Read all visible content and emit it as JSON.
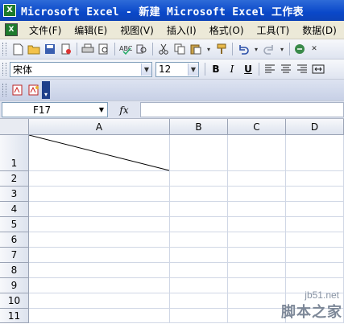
{
  "window": {
    "title": "Microsoft Excel - 新建 Microsoft Excel 工作表"
  },
  "menu": {
    "items": [
      {
        "label": "文件(F)"
      },
      {
        "label": "编辑(E)"
      },
      {
        "label": "视图(V)"
      },
      {
        "label": "插入(I)"
      },
      {
        "label": "格式(O)"
      },
      {
        "label": "工具(T)"
      },
      {
        "label": "数据(D)"
      }
    ]
  },
  "formatting": {
    "font_name": "宋体",
    "font_size": "12",
    "bold_label": "B",
    "italic_label": "I",
    "underline_label": "U"
  },
  "formula_bar": {
    "name_box": "F17",
    "fx_label": "fx",
    "formula": ""
  },
  "sheet": {
    "columns": [
      "A",
      "B",
      "C",
      "D"
    ],
    "rows": [
      "1",
      "2",
      "3",
      "4",
      "5",
      "6",
      "7",
      "8",
      "9",
      "10",
      "11"
    ]
  },
  "watermark": {
    "url": "jb51.net",
    "text": "脚本之家"
  }
}
